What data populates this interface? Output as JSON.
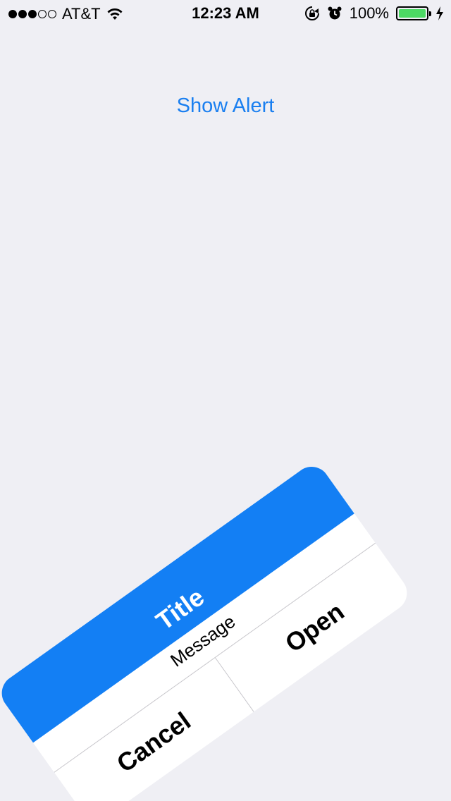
{
  "status_bar": {
    "carrier": "AT&T",
    "time": "12:23 AM",
    "battery_percent": "100%",
    "battery_level": 1.0,
    "signal_strength": 3,
    "signal_max": 5
  },
  "main": {
    "show_alert_label": "Show Alert"
  },
  "alert": {
    "title": "Title",
    "message": "Message",
    "cancel_label": "Cancel",
    "open_label": "Open"
  },
  "colors": {
    "accent": "#137ff4",
    "link": "#1a7ff0",
    "battery": "#4cd964",
    "background": "#efeff4"
  }
}
